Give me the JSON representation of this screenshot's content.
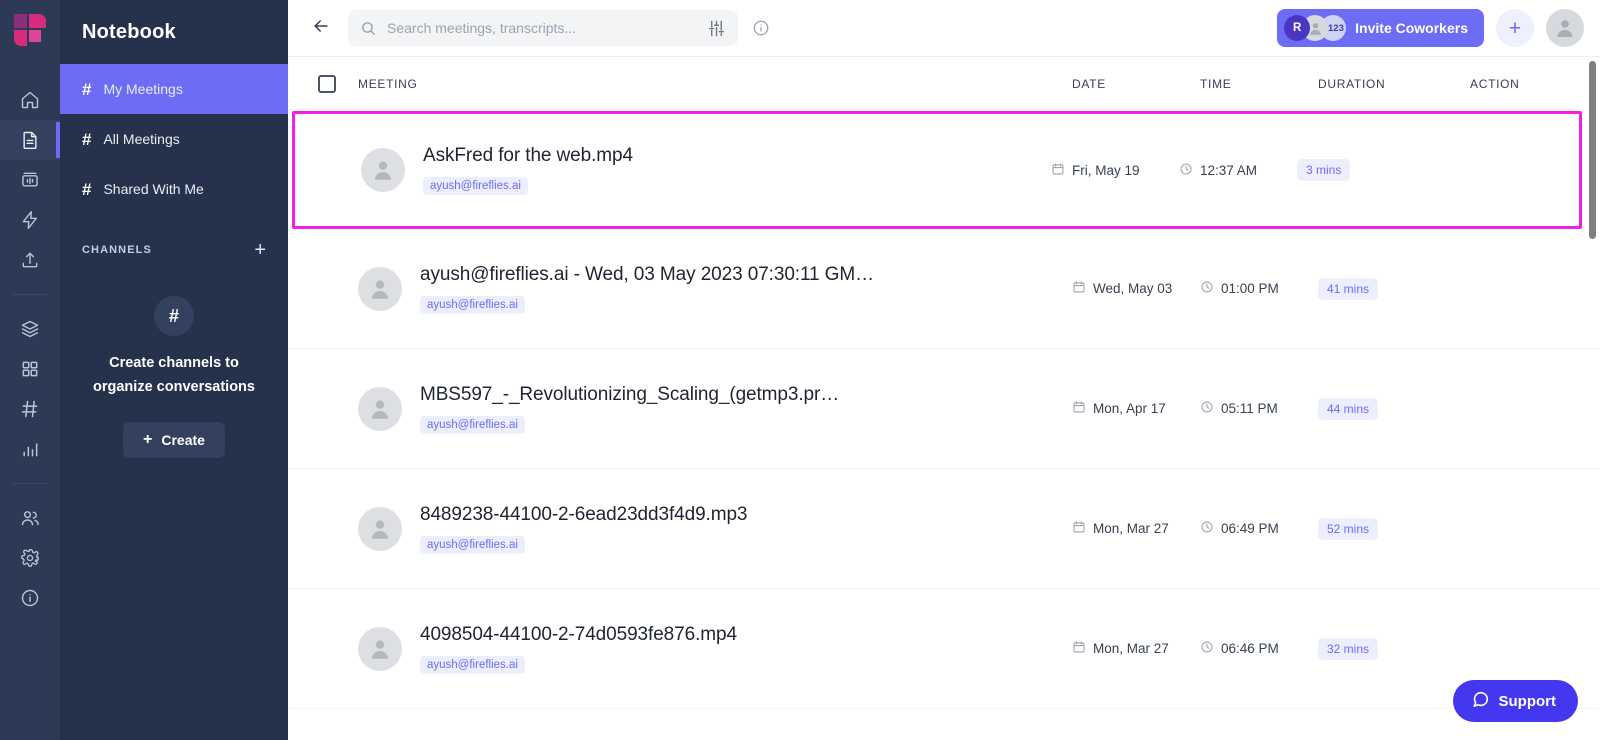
{
  "brand": {
    "logo_name": "fireflies-logo",
    "accent": "#6c6cf5",
    "highlight": "#f81ce5"
  },
  "rail": {
    "items": [
      {
        "icon": "home-icon",
        "name": "home"
      },
      {
        "icon": "document-icon",
        "name": "notebook",
        "active": true
      },
      {
        "icon": "soundwave-icon",
        "name": "soundbites"
      },
      {
        "icon": "lightning-icon",
        "name": "automations"
      },
      {
        "icon": "upload-icon",
        "name": "upload"
      },
      {
        "icon": "layers-icon",
        "name": "topics"
      },
      {
        "icon": "grid-icon",
        "name": "apps"
      },
      {
        "icon": "hash-icon",
        "name": "channels"
      },
      {
        "icon": "bar-chart-icon",
        "name": "analytics"
      },
      {
        "icon": "people-icon",
        "name": "team"
      },
      {
        "icon": "gear-icon",
        "name": "settings"
      },
      {
        "icon": "info-icon",
        "name": "help"
      }
    ]
  },
  "sidebar": {
    "title": "Notebook",
    "items": [
      {
        "label": "My Meetings",
        "active": true
      },
      {
        "label": "All Meetings",
        "active": false
      },
      {
        "label": "Shared With Me",
        "active": false
      }
    ],
    "channels": {
      "header": "CHANNELS",
      "add_label": "+",
      "empty_icon": "#",
      "empty_text": "Create channels to organize conversations",
      "create_label": "Create",
      "create_plus": "+"
    }
  },
  "topbar": {
    "back_label": "←",
    "search": {
      "value": "",
      "placeholder": "Search meetings, transcripts..."
    },
    "filter_icon": "filter-sliders-icon",
    "info_icon": "info-circle-icon",
    "invite": {
      "label": "Invite Coworkers",
      "avatar_initial": "R",
      "overflow_count": "+123"
    },
    "add_label": "+",
    "user_avatar": "user-avatar"
  },
  "table": {
    "columns": {
      "meeting": "MEETING",
      "date": "DATE",
      "time": "TIME",
      "duration": "DURATION",
      "action": "ACTION"
    },
    "select_all_checked": false,
    "rows": [
      {
        "title": "AskFred for the web.mp4",
        "owner": "ayush@fireflies.ai",
        "date": "Fri, May 19",
        "time": "12:37 AM",
        "duration": "3 mins",
        "selected": true
      },
      {
        "title": "ayush@fireflies.ai - Wed, 03 May 2023 07:30:11 GM…",
        "owner": "ayush@fireflies.ai",
        "date": "Wed, May 03",
        "time": "01:00 PM",
        "duration": "41 mins",
        "selected": false
      },
      {
        "title": "MBS597_-_Revolutionizing_Scaling_(getmp3.pr…",
        "owner": "ayush@fireflies.ai",
        "date": "Mon, Apr 17",
        "time": "05:11 PM",
        "duration": "44 mins",
        "selected": false
      },
      {
        "title": "8489238-44100-2-6ead23dd3f4d9.mp3",
        "owner": "ayush@fireflies.ai",
        "date": "Mon, Mar 27",
        "time": "06:49 PM",
        "duration": "52 mins",
        "selected": false
      },
      {
        "title": "4098504-44100-2-74d0593fe876.mp4",
        "owner": "ayush@fireflies.ai",
        "date": "Mon, Mar 27",
        "time": "06:46 PM",
        "duration": "32 mins",
        "selected": false
      }
    ]
  },
  "support": {
    "label": "Support",
    "icon": "chat-bubble-icon"
  }
}
